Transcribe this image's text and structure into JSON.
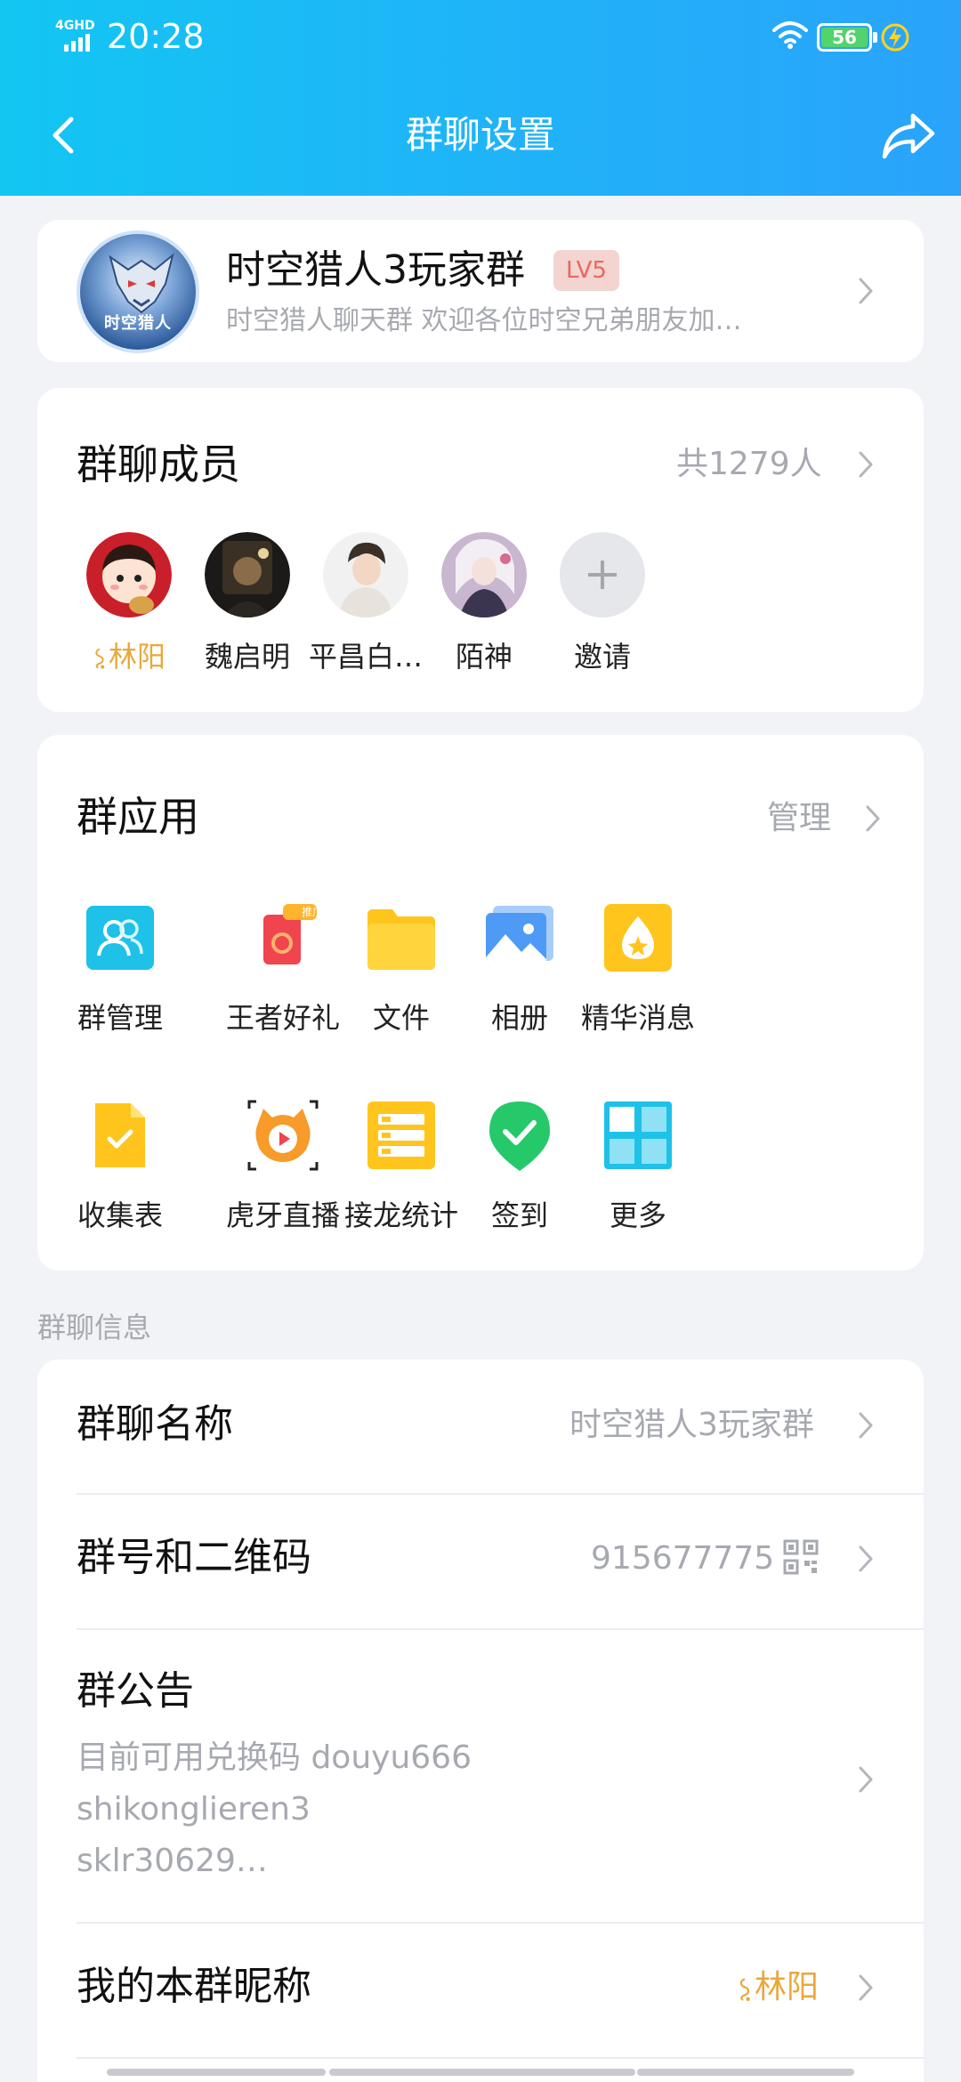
{
  "status_bar": {
    "network": "4GHD",
    "time": "20:28",
    "battery": "56",
    "battery_level": 0.56
  },
  "nav": {
    "title": "群聊设置"
  },
  "group": {
    "avatar_text": "时空猎人",
    "name": "时空猎人3玩家群",
    "level": "LV5",
    "description": "时空猎人聊天群 欢迎各位时空兄弟朋友加…"
  },
  "members": {
    "title": "群聊成员",
    "count": "共1279人",
    "list": [
      {
        "name": "林阳",
        "badge_icon": "rank-crown-icon",
        "highlight": true
      },
      {
        "name": "魏启明"
      },
      {
        "name": "平昌白…"
      },
      {
        "name": "陌神"
      }
    ],
    "invite_label": "邀请"
  },
  "apps": {
    "title": "群应用",
    "manage_label": "管理",
    "items": [
      {
        "label": "群管理",
        "icon": "group-manage-icon",
        "color": "#1ec1e8"
      },
      {
        "label": "王者好礼",
        "icon": "gift-icon",
        "badge": "推广",
        "color": "#f0444f"
      },
      {
        "label": "文件",
        "icon": "folder-icon",
        "color": "#ffc51c"
      },
      {
        "label": "相册",
        "icon": "album-icon",
        "color": "#4f9af4"
      },
      {
        "label": "精华消息",
        "icon": "essence-icon",
        "color": "#ffc51c"
      },
      {
        "label": "收集表",
        "icon": "form-icon",
        "color": "#ffc51c"
      },
      {
        "label": "虎牙直播",
        "icon": "huya-icon",
        "color": "#f79b2a"
      },
      {
        "label": "接龙统计",
        "icon": "solitaire-icon",
        "color": "#ffc51c"
      },
      {
        "label": "签到",
        "icon": "checkin-icon",
        "color": "#25c96a"
      },
      {
        "label": "更多",
        "icon": "more-grid-icon",
        "color": "#1ec1e8"
      }
    ]
  },
  "info": {
    "section_label": "群聊信息",
    "name_row": {
      "title": "群聊名称",
      "value": "时空猎人3玩家群"
    },
    "id_row": {
      "title": "群号和二维码",
      "value": "915677775"
    },
    "notice_row": {
      "title": "群公告",
      "lines": [
        "目前可用兑换码 douyu666",
        "shikonglieren3",
        "sklr30629…"
      ]
    },
    "nickname_row": {
      "title": "我的本群昵称",
      "value": "林阳"
    }
  }
}
